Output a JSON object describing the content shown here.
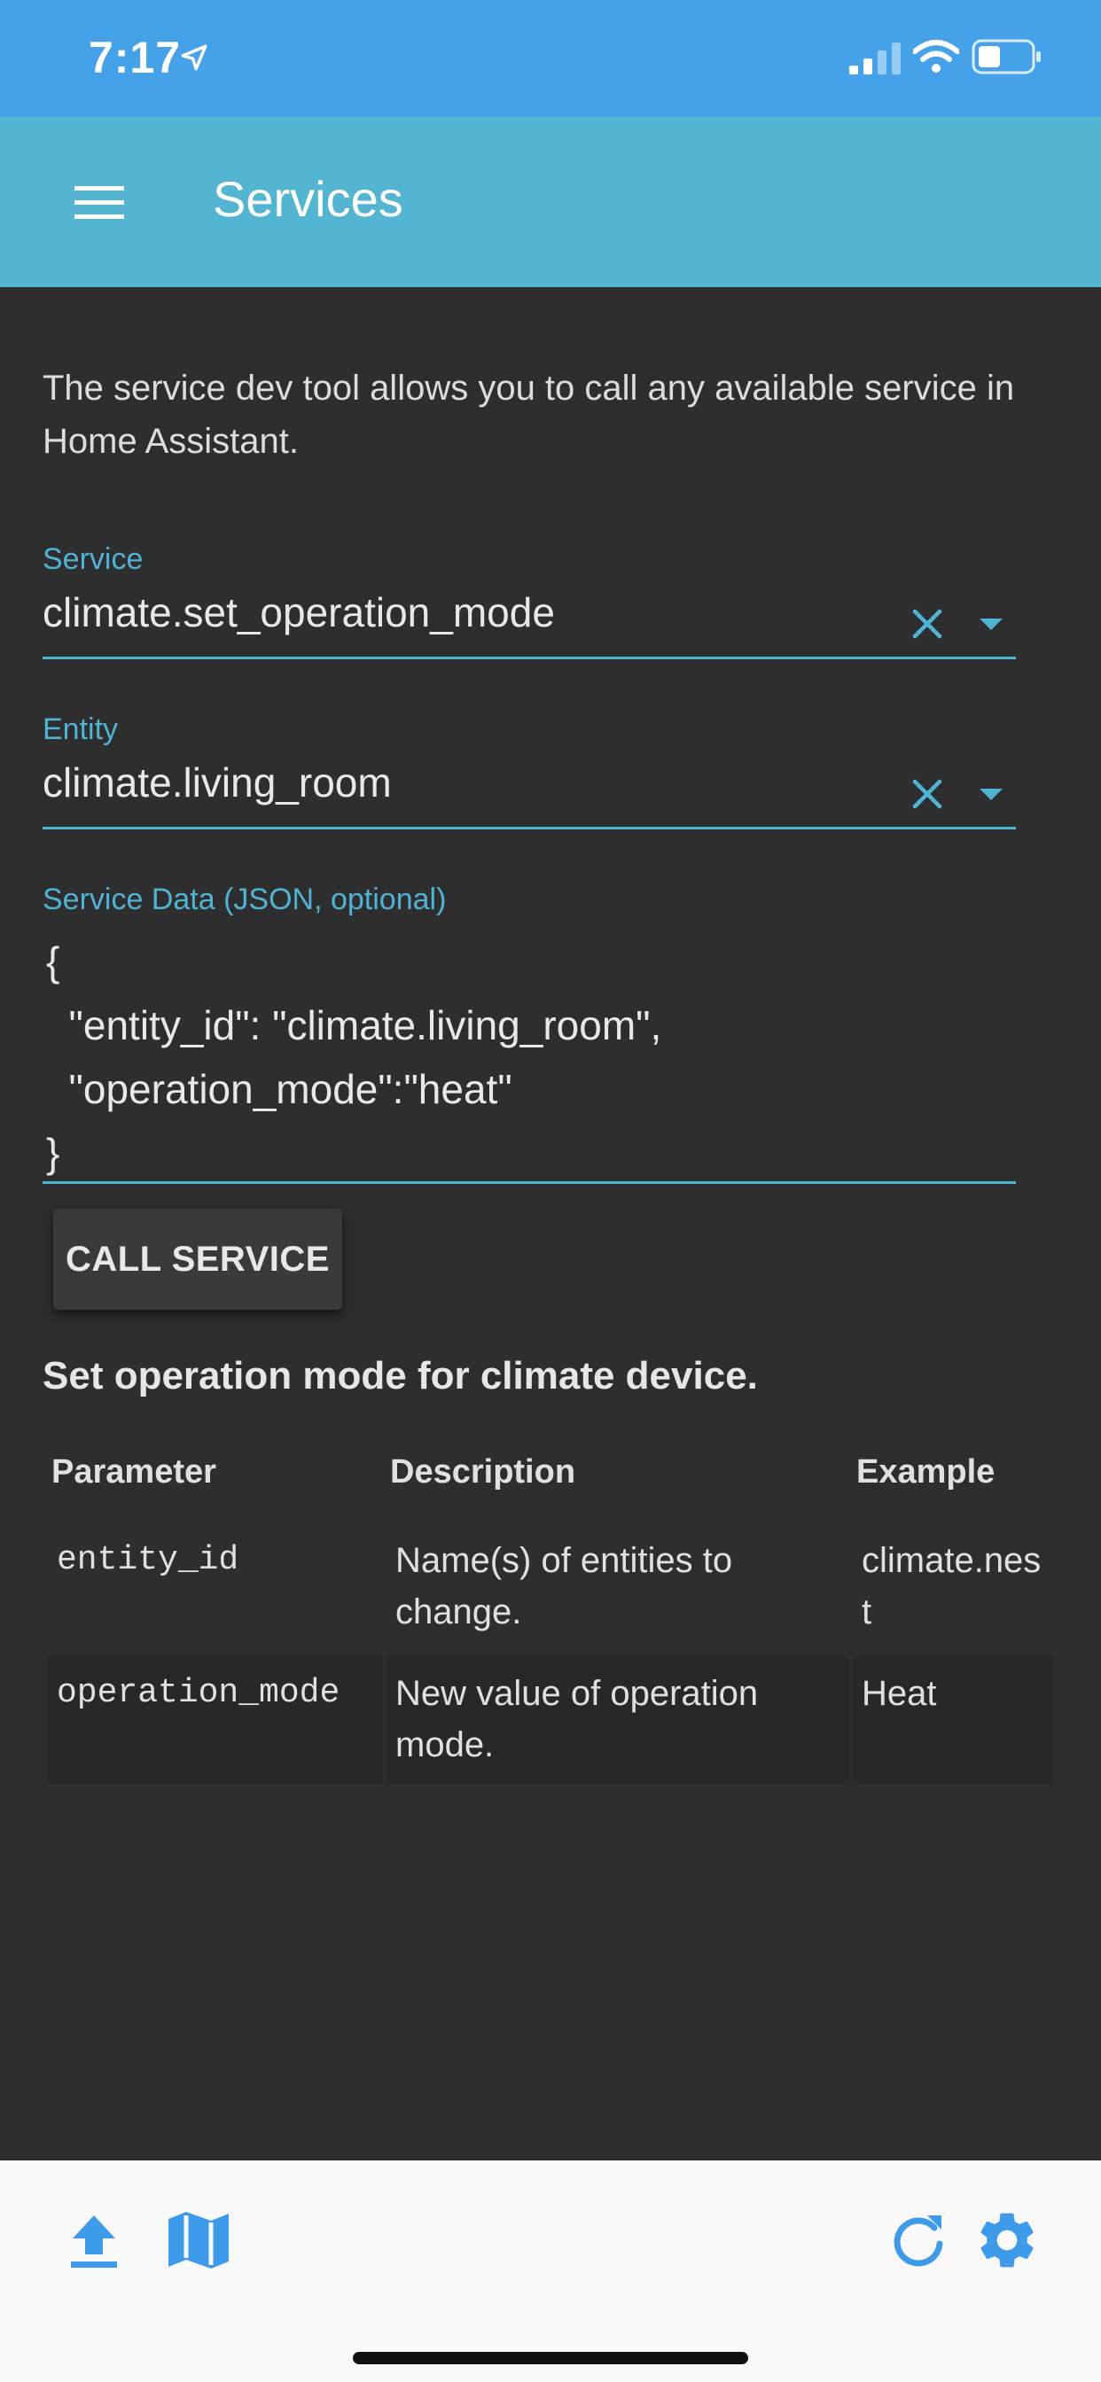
{
  "status_bar": {
    "time": "7:17",
    "location_icon": "location-arrow-icon",
    "signal_icon": "cellular-signal-icon",
    "wifi_icon": "wifi-icon",
    "battery_icon": "battery-icon",
    "colors": {
      "background": "#45a2e8"
    }
  },
  "app_bar": {
    "title": "Services",
    "menu_icon": "hamburger-menu-icon",
    "colors": {
      "background": "#53b5d1"
    }
  },
  "intro_text": "The service dev tool allows you to call any available service in Home Assistant.",
  "service_field": {
    "label": "Service",
    "value": "climate.set_operation_mode"
  },
  "entity_field": {
    "label": "Entity",
    "value": "climate.living_room"
  },
  "service_data": {
    "label": "Service Data (JSON, optional)",
    "lines": [
      "{",
      "  \"entity_id\": \"climate.living_room\",",
      "  \"operation_mode\":\"heat\"",
      "}"
    ]
  },
  "call_service_button": "CALL SERVICE",
  "service_description": "Set operation mode for climate device.",
  "table": {
    "headers": [
      "Parameter",
      "Description",
      "Example"
    ],
    "rows": [
      {
        "parameter": "entity_id",
        "description": "Name(s) of entities to change.",
        "example": "climate.nest"
      },
      {
        "parameter": "operation_mode",
        "description": "New value of operation mode.",
        "example": "Heat"
      }
    ]
  },
  "toolbar": {
    "left_icons": [
      "upload-icon",
      "map-icon"
    ],
    "right_icons": [
      "refresh-icon",
      "settings-gear-icon"
    ]
  },
  "colors": {
    "accent": "#4fb3d6",
    "background": "#2e2e2e",
    "toolbar_icon": "#3d9be9"
  }
}
